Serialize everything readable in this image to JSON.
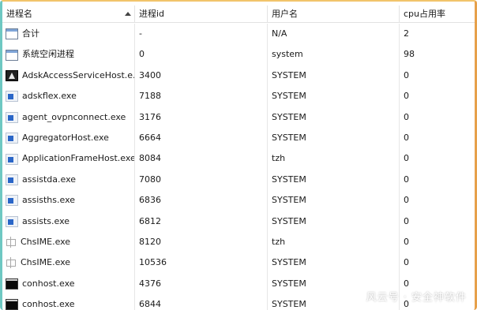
{
  "columns": [
    "进程名",
    "进程id",
    "用户名",
    "cpu占用率"
  ],
  "rows": [
    {
      "icon": "window-icon",
      "name": "合计",
      "pid": "-",
      "user": "N/A",
      "cpu": "2"
    },
    {
      "icon": "window-icon",
      "name": "系统空闲进程",
      "pid": "0",
      "user": "system",
      "cpu": "98"
    },
    {
      "icon": "autodesk-icon",
      "name": "AdskAccessServiceHost.e...",
      "pid": "3400",
      "user": "SYSTEM",
      "cpu": "0"
    },
    {
      "icon": "exe-icon",
      "name": "adskflex.exe",
      "pid": "7188",
      "user": "SYSTEM",
      "cpu": "0"
    },
    {
      "icon": "exe-icon",
      "name": "agent_ovpnconnect.exe",
      "pid": "3176",
      "user": "SYSTEM",
      "cpu": "0"
    },
    {
      "icon": "exe-icon",
      "name": "AggregatorHost.exe",
      "pid": "6664",
      "user": "SYSTEM",
      "cpu": "0"
    },
    {
      "icon": "exe-icon",
      "name": "ApplicationFrameHost.exe",
      "pid": "8084",
      "user": "tzh",
      "cpu": "0"
    },
    {
      "icon": "exe-icon",
      "name": "assistda.exe",
      "pid": "7080",
      "user": "SYSTEM",
      "cpu": "0"
    },
    {
      "icon": "exe-icon",
      "name": "assisths.exe",
      "pid": "6836",
      "user": "SYSTEM",
      "cpu": "0"
    },
    {
      "icon": "exe-icon",
      "name": "assists.exe",
      "pid": "6812",
      "user": "SYSTEM",
      "cpu": "0"
    },
    {
      "icon": "chs-ime-icon",
      "name": "ChsIME.exe",
      "pid": "8120",
      "user": "tzh",
      "cpu": "0"
    },
    {
      "icon": "chs-ime-icon",
      "name": "ChsIME.exe",
      "pid": "10536",
      "user": "SYSTEM",
      "cpu": "0"
    },
    {
      "icon": "console-icon",
      "name": "conhost.exe",
      "pid": "4376",
      "user": "SYSTEM",
      "cpu": "0"
    },
    {
      "icon": "console-icon",
      "name": "conhost.exe",
      "pid": "6844",
      "user": "SYSTEM",
      "cpu": "0"
    }
  ],
  "watermark": "风云号 · 安全神软件"
}
